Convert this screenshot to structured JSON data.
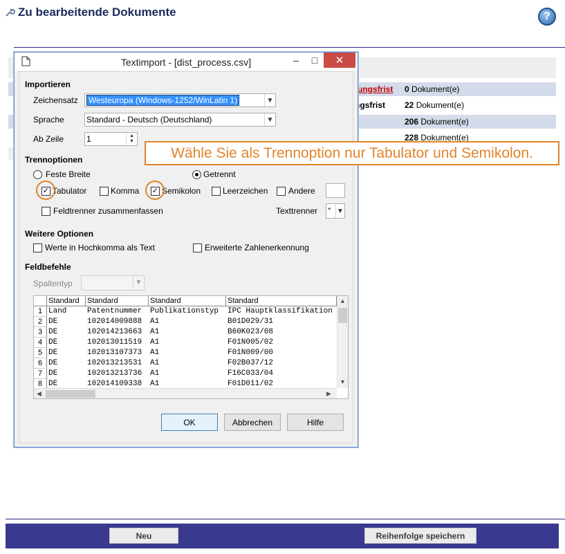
{
  "page": {
    "title": "Zu bearbeitende Dokumente",
    "help_symbol": "?"
  },
  "background_rows": [
    {
      "label": "tungsfrist",
      "count": "0",
      "unit": "Dokument(e)"
    },
    {
      "label": "ngsfrist",
      "count": "22",
      "unit": "Dokument(e)"
    },
    {
      "label": "",
      "count": "206",
      "unit": "Dokument(e)"
    },
    {
      "label": "",
      "count": "228",
      "unit": "Dokument(e)"
    }
  ],
  "dialog": {
    "title": "Textimport - [dist_process.csv]",
    "controls": {
      "minimize": "–",
      "maximize": "□",
      "close": "✕"
    },
    "import_section": {
      "heading": "Importieren",
      "charset_label": "Zeichensatz",
      "charset_value": "Westeuropa (Windows-1252/WinLatin 1)",
      "language_label": "Sprache",
      "language_value": "Standard - Deutsch (Deutschland)",
      "from_row_label": "Ab Zeile",
      "from_row_value": "1"
    },
    "separator_section": {
      "heading": "Trennoptionen",
      "fixed_width": "Feste Breite",
      "separated": "Getrennt",
      "tab": "Tabulator",
      "comma": "Komma",
      "semicolon": "Semikolon",
      "space": "Leerzeichen",
      "other": "Andere",
      "merge": "Feldtrenner zusammenfassen",
      "text_delimiter_label": "Texttrenner",
      "text_delimiter_value": "\""
    },
    "more_options": {
      "heading": "Weitere Optionen",
      "quoted_as_text": "Werte in Hochkomma als Text",
      "extended_numbers": "Erweiterte Zahlenerkennung"
    },
    "fields": {
      "heading": "Feldbefehle",
      "column_type_label": "Spaltentyp"
    },
    "preview": {
      "headers": [
        "Standard",
        "Standard",
        "Standard",
        "Standard"
      ],
      "rows": [
        [
          "1",
          "Land",
          "Patentnummer",
          "Publikationstyp",
          "IPC Hauptklassifikation"
        ],
        [
          "2",
          " DE",
          "102014009888",
          "A1",
          "B01D029/31"
        ],
        [
          "3",
          "DE",
          "102014213663",
          "A1",
          "B60K023/08"
        ],
        [
          "4",
          "DE",
          "102013011519",
          "A1",
          "F01N005/02"
        ],
        [
          "5",
          "DE",
          "102013107373",
          "A1",
          "F01N009/00"
        ],
        [
          "6",
          "DE",
          "102013213531",
          "A1",
          "F02B037/12"
        ],
        [
          "7",
          "DE",
          "102013213736",
          "A1",
          "F16C033/04"
        ],
        [
          "8",
          "DE",
          "102014109338",
          "A1",
          "F01D011/02"
        ]
      ]
    },
    "buttons": {
      "ok": "OK",
      "cancel": "Abbrechen",
      "help": "Hilfe"
    }
  },
  "callout": "Wähle Sie als Trennoption nur Tabulator und Semikolon.",
  "footer": {
    "new": "Neu",
    "save_order": "Reihenfolge speichern"
  },
  "colors": {
    "accent": "#e0842a",
    "navy": "#3a3990",
    "row_blue": "#d4dbeb"
  }
}
